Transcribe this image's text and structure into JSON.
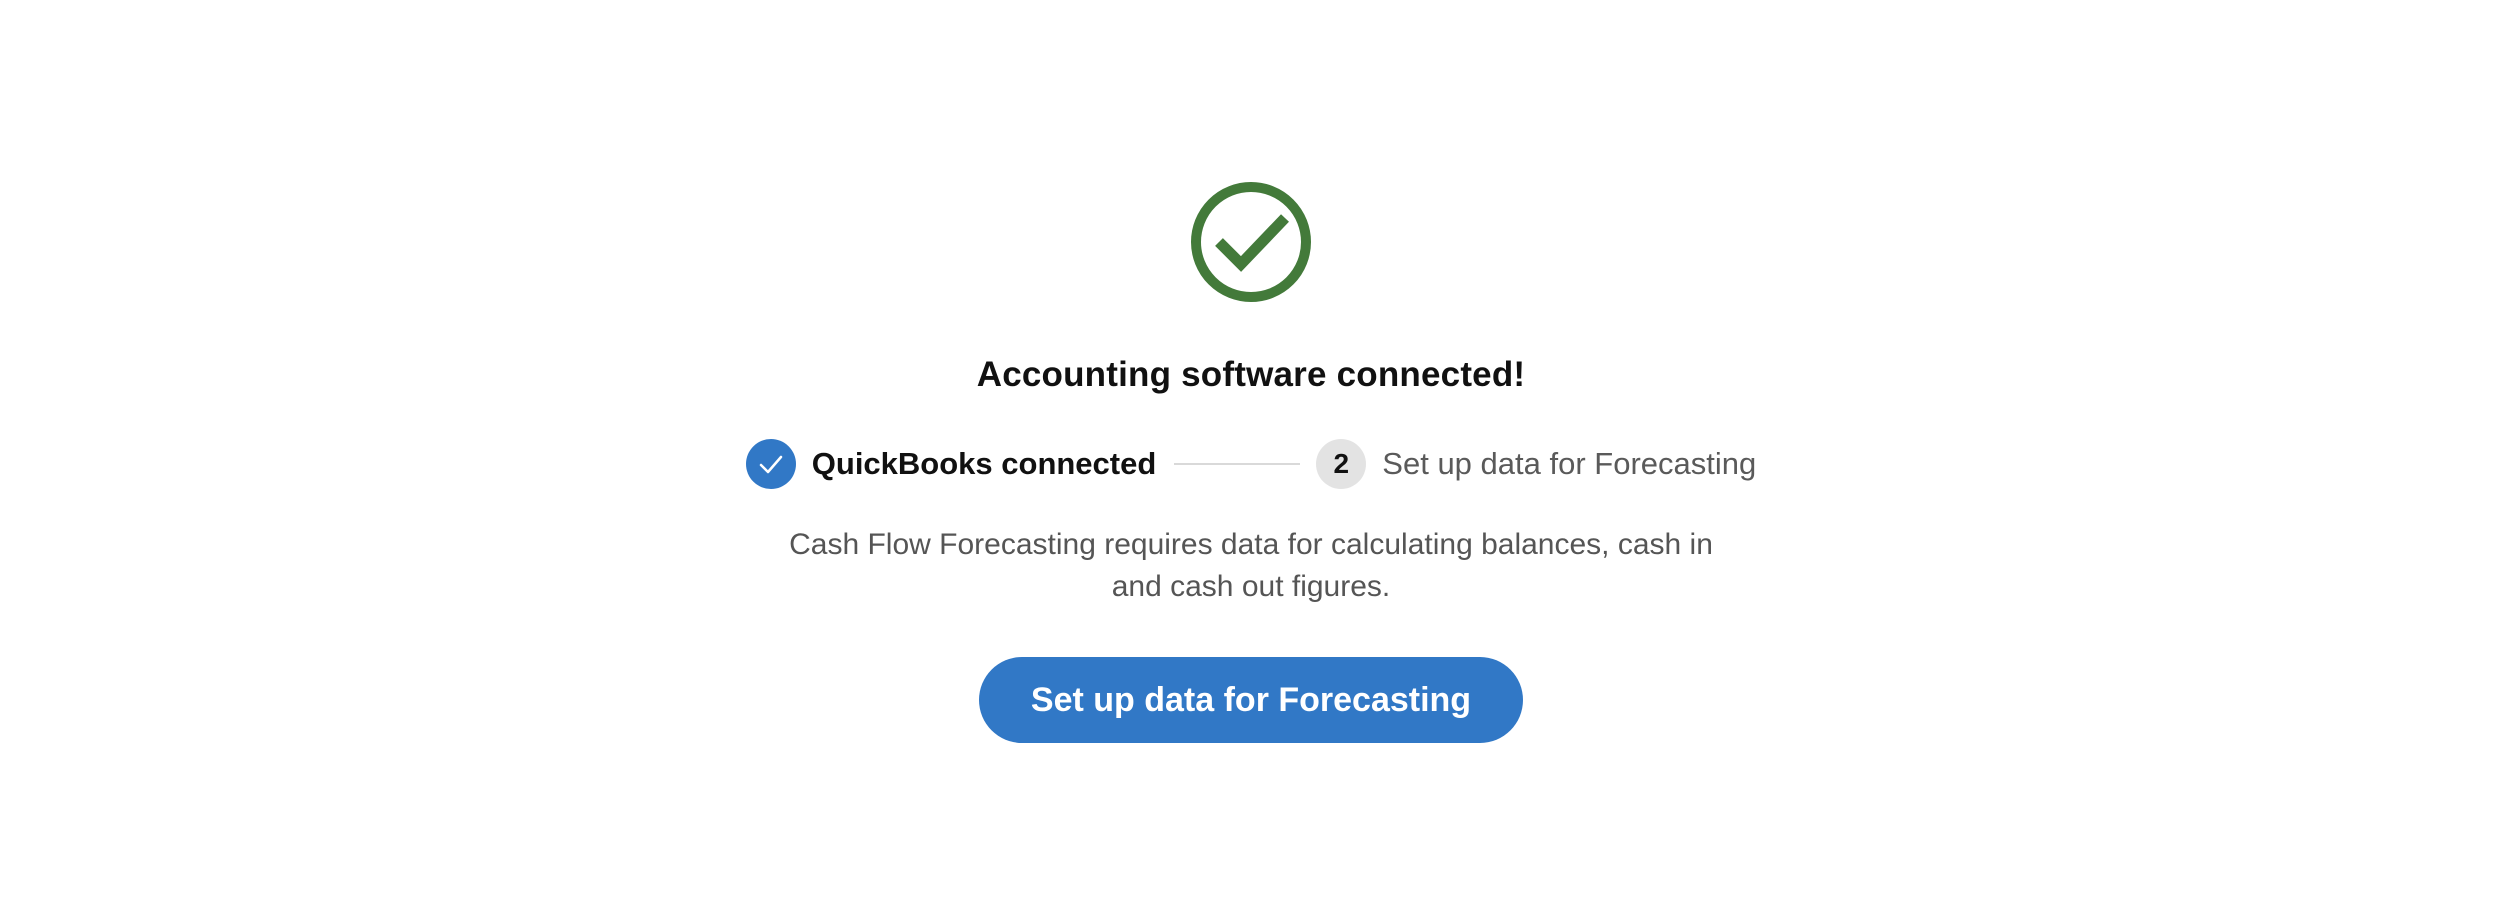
{
  "success": {
    "icon": "check-circle-icon",
    "color": "#437a3a",
    "title": "Accounting software connected!"
  },
  "stepper": {
    "steps": [
      {
        "status": "completed",
        "icon": "checkmark-icon",
        "label": "QuickBooks connected"
      },
      {
        "status": "pending",
        "number": "2",
        "label": "Set up data for Forecasting"
      }
    ]
  },
  "description": "Cash Flow Forecasting requires data for calculating balances, cash in and cash out figures.",
  "cta": {
    "label": "Set up data for Forecasting",
    "color": "#3178c6"
  }
}
